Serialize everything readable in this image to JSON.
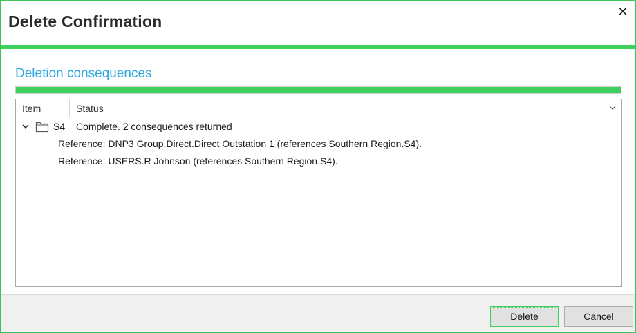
{
  "dialog": {
    "title": "Delete Confirmation",
    "close_glyph": "✕",
    "accent_color": "#3fcf5c"
  },
  "consequences": {
    "heading": "Deletion consequences",
    "heading_color": "#2ea8e0",
    "progress_fraction": 1.0
  },
  "grid": {
    "columns": [
      "Item",
      "Status"
    ],
    "rows": [
      {
        "item": "S4",
        "icon": "folder-icon",
        "expanded": true,
        "status": "Complete. 2 consequences returned",
        "children": [
          "Reference: DNP3 Group.Direct.Direct Outstation 1 (references Southern Region.S4).",
          "Reference: USERS.R Johnson (references Southern Region.S4)."
        ]
      }
    ]
  },
  "footer": {
    "delete_label": "Delete",
    "cancel_label": "Cancel"
  }
}
